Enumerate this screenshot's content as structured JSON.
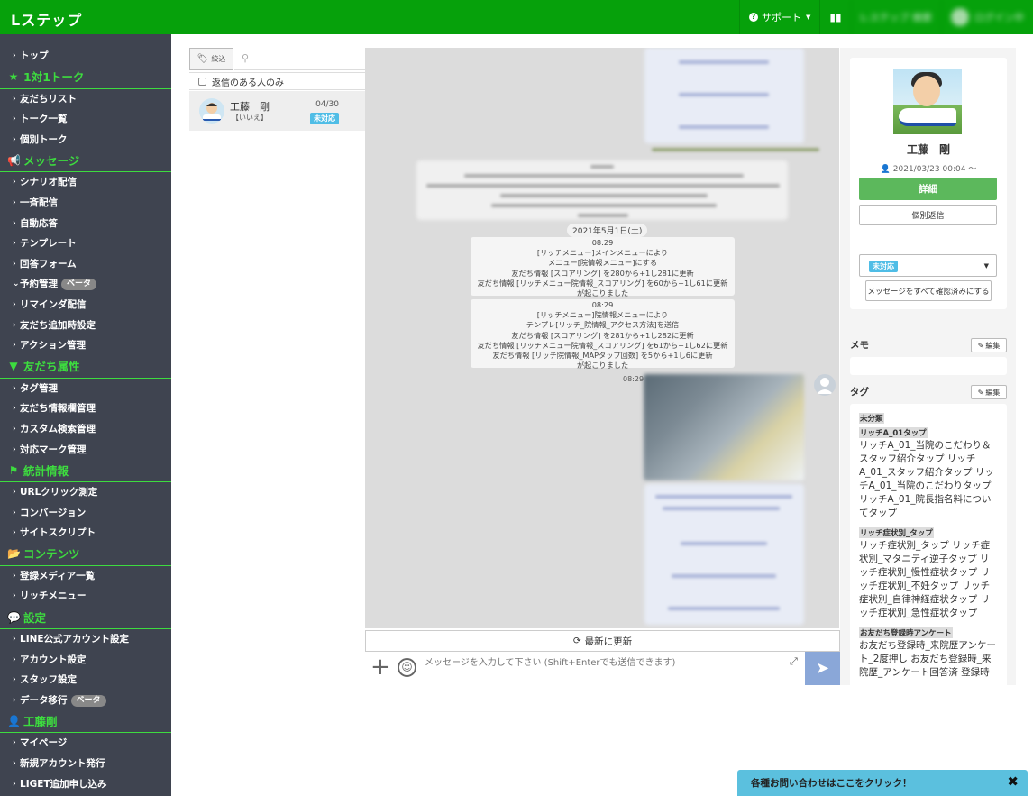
{
  "topbar": {
    "logo": "Lステップ",
    "support_label": "サポート",
    "account_label": "L-ステップ 検索",
    "user_label": "ログイン中"
  },
  "sidebar": {
    "items": [
      {
        "type": "item",
        "label": "トップ"
      },
      {
        "type": "head",
        "icon": "★",
        "label": "1対1トーク"
      },
      {
        "type": "item",
        "label": "友だちリスト"
      },
      {
        "type": "item",
        "label": "トーク一覧"
      },
      {
        "type": "item",
        "label": "個別トーク"
      },
      {
        "type": "head",
        "icon": "📢",
        "label": "メッセージ"
      },
      {
        "type": "item",
        "label": "シナリオ配信"
      },
      {
        "type": "item",
        "label": "一斉配信"
      },
      {
        "type": "item",
        "label": "自動応答"
      },
      {
        "type": "item",
        "label": "テンプレート"
      },
      {
        "type": "item",
        "label": "回答フォーム"
      },
      {
        "type": "item",
        "label": "予約管理",
        "beta": "ベータ",
        "open": true
      },
      {
        "type": "item",
        "label": "リマインダ配信"
      },
      {
        "type": "item",
        "label": "友だち追加時設定"
      },
      {
        "type": "item",
        "label": "アクション管理"
      },
      {
        "type": "head",
        "icon": "▼",
        "label": "友だち属性"
      },
      {
        "type": "item",
        "label": "タグ管理"
      },
      {
        "type": "item",
        "label": "友だち情報欄管理"
      },
      {
        "type": "item",
        "label": "カスタム検索管理"
      },
      {
        "type": "item",
        "label": "対応マーク管理"
      },
      {
        "type": "head",
        "icon": "⚑",
        "label": "統計情報"
      },
      {
        "type": "item",
        "label": "URLクリック測定"
      },
      {
        "type": "item",
        "label": "コンバージョン"
      },
      {
        "type": "item",
        "label": "サイトスクリプト"
      },
      {
        "type": "head",
        "icon": "📂",
        "label": "コンテンツ"
      },
      {
        "type": "item",
        "label": "登録メディア一覧"
      },
      {
        "type": "item",
        "label": "リッチメニュー"
      },
      {
        "type": "head",
        "icon": "💬",
        "label": "設定"
      },
      {
        "type": "item",
        "label": "LINE公式アカウント設定"
      },
      {
        "type": "item",
        "label": "アカウント設定"
      },
      {
        "type": "item",
        "label": "スタッフ設定"
      },
      {
        "type": "item",
        "label": "データ移行",
        "beta": "ベータ"
      },
      {
        "type": "head",
        "icon": "👤",
        "label": "工藤剛"
      },
      {
        "type": "item",
        "label": "マイページ"
      },
      {
        "type": "item",
        "label": "新規アカウント発行"
      },
      {
        "type": "item",
        "label": "LIGET追加申し込み"
      }
    ]
  },
  "list": {
    "tag_filter_label": "絞込",
    "reply_only_label": "返信のある人のみ",
    "friend": {
      "name": "工藤　剛",
      "sub": "【いいえ】",
      "date": "04/30",
      "badge": "未対応"
    }
  },
  "chat": {
    "date_pill": "2021年5月1日(土)",
    "system_messages": [
      {
        "lines": [
          "08:29",
          "[リッチメニュー]メインメニューにより",
          "メニュー[院情報メニュー]にする",
          "友だち情報 [スコアリング] を280から+1し281に更新",
          "友だち情報 [リッチメニュー院情報_スコアリング] を60から+1し61に更新",
          "が起こりました"
        ]
      },
      {
        "lines": [
          "08:29",
          "[リッチメニュー]院情報メニューにより",
          "テンプレ[リッチ_院情報_アクセス方法]を送信",
          "友だち情報 [スコアリング] を281から+1し282に更新",
          "友だち情報 [リッチメニュー院情報_スコアリング] を61から+1し62に更新",
          "友だち情報 [リッチ院情報_MAPタップ回数] を5から+1し6に更新",
          "が起こりました"
        ]
      }
    ],
    "photo_time": "08:29",
    "refresh_label": "最新に更新",
    "input_placeholder": "メッセージを入力して下さい (Shift+Enterでも送信できます)"
  },
  "profile": {
    "name": "工藤　剛",
    "registered": "2021/03/23 00:04 〜",
    "detail_label": "詳細",
    "reply_label": "個別返信",
    "status_badge": "未対応",
    "confirm_label": "メッセージをすべて確認済みにする"
  },
  "memo": {
    "title": "メモ",
    "edit_label": "編集"
  },
  "tags": {
    "title": "タグ",
    "edit_label": "編集",
    "groups": [
      {
        "category": "未分類",
        "text": ""
      },
      {
        "category": "リッチA_01タップ",
        "text": "リッチA_01_当院のこだわり＆スタッフ紹介タップ リッチA_01_スタッフ紹介タップ リッチA_01_当院のこだわりタップ リッチA_01_院長指名料についてタップ"
      },
      {
        "category": "リッチ症状別_タップ",
        "text": "リッチ症状別_タップ リッチ症状別_マタニティ逆子タップ リッチ症状別_慢性症状タップ リッチ症状別_不妊タップ リッチ症状別_自律神経症状タップ リッチ症状別_急性症状タップ"
      },
      {
        "category": "お友だち登録時アンケート",
        "text": "お友だち登録時_来院歴アンケート_2度押し お友だち登録時_来院歴_アンケート回答済 登録時"
      }
    ]
  },
  "help": {
    "label": "各種お問い合わせはここをクリック！",
    "close": "✖"
  }
}
